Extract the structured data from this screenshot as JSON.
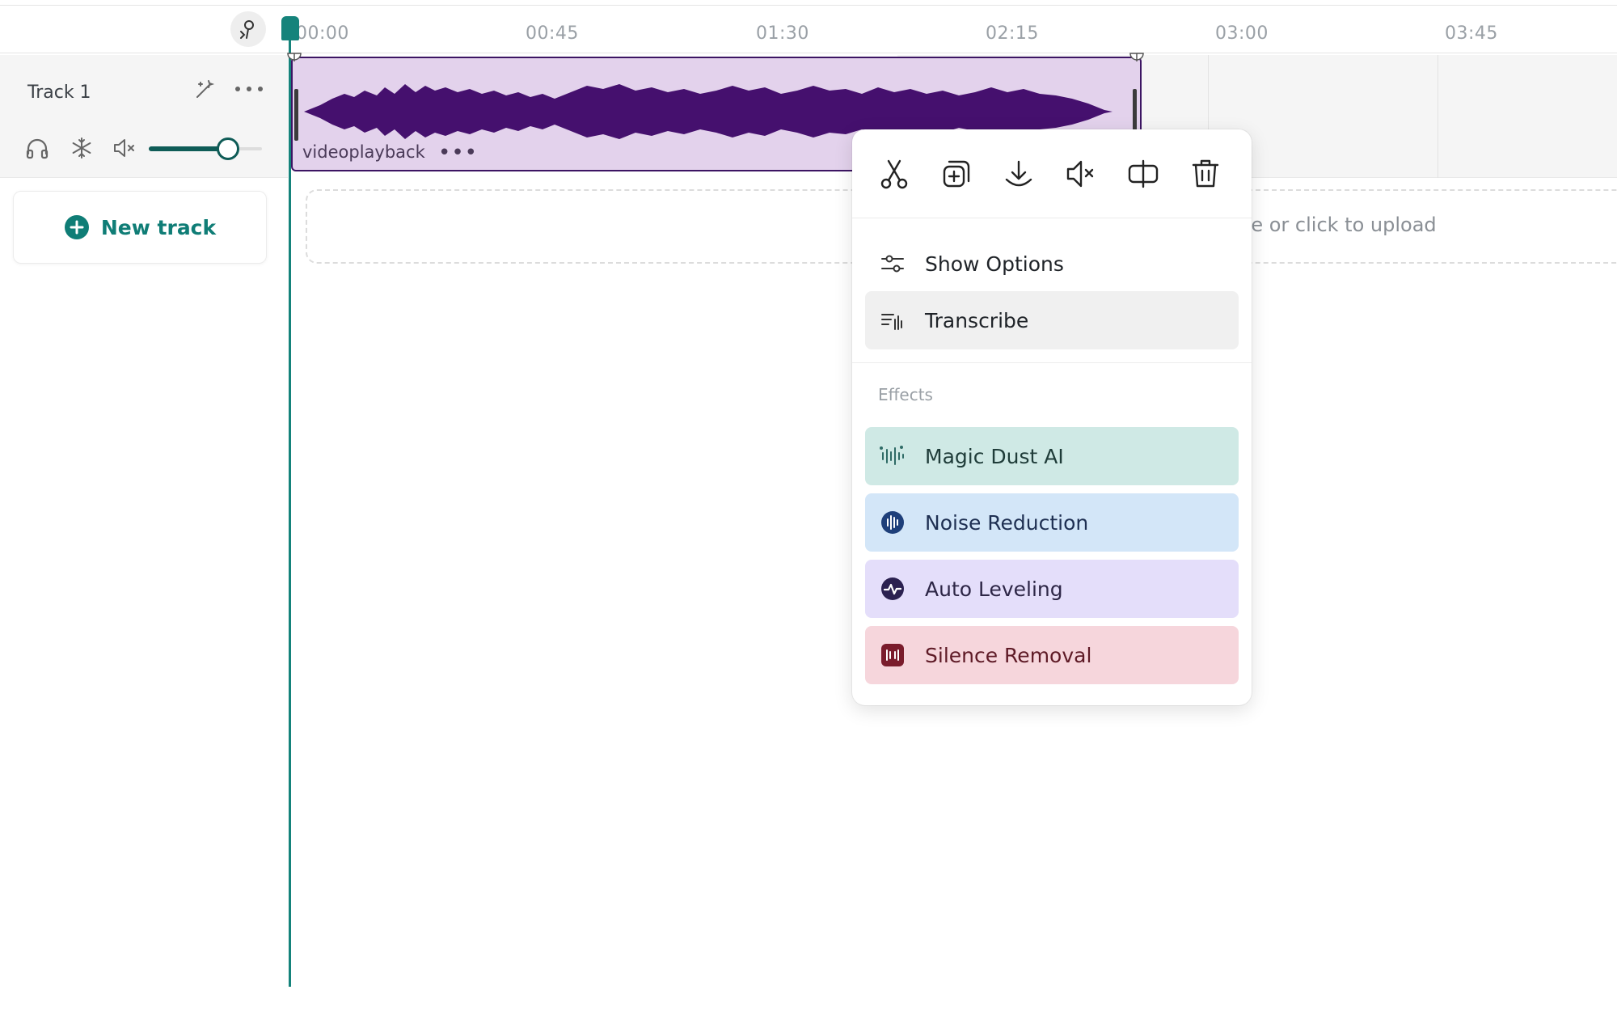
{
  "ruler": {
    "ticks": [
      "00:00",
      "00:45",
      "01:30",
      "02:15",
      "03:00",
      "03:45"
    ]
  },
  "track": {
    "name": "Track 1",
    "volume_percent": 70
  },
  "clip": {
    "name": "videoplayback",
    "more": "•••"
  },
  "new_track": {
    "label": "New track"
  },
  "drop_zone": {
    "text": "re or click to upload"
  },
  "context_menu": {
    "toolbar": [
      "scissors-icon",
      "duplicate-icon",
      "download-icon",
      "mute-icon",
      "split-icon",
      "trash-icon"
    ],
    "show_options": "Show Options",
    "transcribe": "Transcribe",
    "effects_header": "Effects",
    "effects": [
      {
        "label": "Magic Dust AI",
        "bg": "#cfe9e5",
        "icon_color": "#2f6b66",
        "text_color": "#1f3c39"
      },
      {
        "label": "Noise Reduction",
        "bg": "#d3e6f8",
        "icon_color": "#1e3f7a",
        "text_color": "#1e2f52"
      },
      {
        "label": "Auto Leveling",
        "bg": "#e4defa",
        "icon_color": "#2b2150",
        "text_color": "#2d2646"
      },
      {
        "label": "Silence Removal",
        "bg": "#f6d6dc",
        "icon_color": "#7a1c2c",
        "text_color": "#5e1a26"
      }
    ]
  },
  "colors": {
    "accent": "#15837b",
    "clip_bg": "#e3d2ec",
    "clip_wave": "#45106e"
  }
}
